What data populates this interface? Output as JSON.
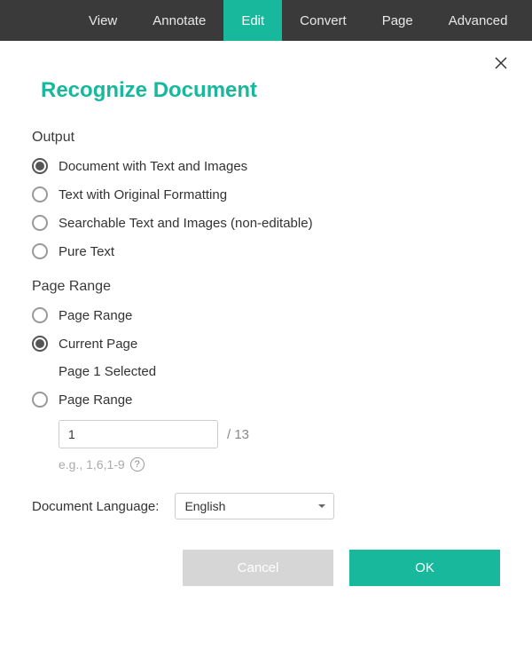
{
  "menubar": {
    "items": [
      {
        "label": "View",
        "active": false
      },
      {
        "label": "Annotate",
        "active": false
      },
      {
        "label": "Edit",
        "active": true
      },
      {
        "label": "Convert",
        "active": false
      },
      {
        "label": "Page",
        "active": false
      },
      {
        "label": "Advanced",
        "active": false
      }
    ]
  },
  "dialog": {
    "title": "Recognize Document",
    "output": {
      "label": "Output",
      "options": [
        {
          "label": "Document with Text and Images",
          "checked": true
        },
        {
          "label": "Text with Original Formatting",
          "checked": false
        },
        {
          "label": " Searchable Text and Images (non-editable)",
          "checked": false
        },
        {
          "label": "Pure Text",
          "checked": false
        }
      ]
    },
    "page_range": {
      "label": "Page Range",
      "options": [
        {
          "label": "Page Range",
          "checked": false
        },
        {
          "label": "Current Page",
          "checked": true,
          "sublabel": "Page 1 Selected"
        },
        {
          "label": "Page Range",
          "checked": false
        }
      ],
      "input_value": "1",
      "total_pages": "/ 13",
      "hint": "e.g., 1,6,1-9"
    },
    "language": {
      "label": "Document Language:",
      "selected": "English"
    },
    "buttons": {
      "cancel": "Cancel",
      "ok": "OK"
    }
  }
}
